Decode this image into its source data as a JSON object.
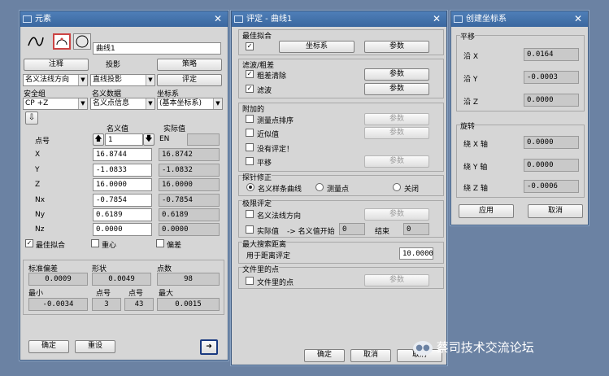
{
  "w1": {
    "title": "元素",
    "name_value": "曲线1",
    "note": "注释",
    "proj_label": "投影",
    "strategy": "策略",
    "sel1": "名义法线方向",
    "sel2": "直线投影",
    "eval": "评定",
    "col_safety": "安全组",
    "col_nominal_data": "名义数据",
    "col_coord": "坐标系",
    "sel3": "CP +Z",
    "sel4": "名义点信息",
    "sel5": "(基本坐标系)",
    "head_point": "点号",
    "head_nominal": "名义值",
    "head_actual": "实际值",
    "point_no": "1",
    "en": "EN",
    "rows": [
      {
        "label": "X",
        "nominal": "16.8744",
        "actual": "16.8742"
      },
      {
        "label": "Y",
        "nominal": "-1.0833",
        "actual": "-1.0832"
      },
      {
        "label": "Z",
        "nominal": "16.0000",
        "actual": "16.0000"
      },
      {
        "label": "Nx",
        "nominal": "-0.7854",
        "actual": "-0.7854"
      },
      {
        "label": "Ny",
        "nominal": "0.6189",
        "actual": "0.6189"
      },
      {
        "label": "Nz",
        "nominal": "0.0000",
        "actual": "0.0000"
      }
    ],
    "chk_bestfit": "最佳拟合",
    "chk_centroid": "重心",
    "chk_dev": "偏差",
    "stat_std": "标准偏差",
    "stat_shape": "形状",
    "stat_points": "点数",
    "std_val": "0.0009",
    "shape_val": "0.0049",
    "points_val": "98",
    "stat_min": "最小",
    "stat_pno1": "点号",
    "stat_pno2": "点号",
    "stat_max": "最大",
    "min_val": "-0.0034",
    "pno1_val": "3",
    "pno2_val": "43",
    "max_val": "0.0015",
    "ok": "确定",
    "reset": "重设"
  },
  "w2": {
    "title": "评定 - 曲线1",
    "best_fit": "最佳拟合",
    "coord_btn": "坐标系",
    "param": "参数",
    "filter_group": "滤波/粗差",
    "outlier": "粗差清除",
    "filter": "滤波",
    "extra_group": "附加的",
    "sort": "测量点排序",
    "approx": "近似值",
    "not_eval": "没有评定！",
    "shift": "平移",
    "probe_group": "探针修正",
    "r_nominal": "名义样条曲线",
    "r_meas": "测量点",
    "r_off": "关闭",
    "limit_group": "极限评定",
    "nominal_normal": "名义法线方向",
    "actual": "实际值",
    "arrow": "-> 名义值开始",
    "start_val": "0",
    "end_label": "结束",
    "end_val": "0",
    "maxdist_group": "最大搜索距离",
    "for_dist": "用于距离评定",
    "dist_val": "10.0000",
    "file_group": "文件里的点",
    "file_chk": "文件里的点",
    "ok": "确定",
    "cancel": "取消",
    "last_btn": "取消"
  },
  "w3": {
    "title": "创建坐标系",
    "shift_group": "平移",
    "along_x": "沿 X",
    "along_y": "沿 Y",
    "along_z": "沿 Z",
    "vx": "0.0164",
    "vy": "-0.0003",
    "vz": "0.0000",
    "rot_group": "旋转",
    "rot_x": "绕 X 轴",
    "rot_y": "绕 Y 轴",
    "rot_z": "绕 Z 轴",
    "rx": "0.0000",
    "ry": "0.0000",
    "rz": "-0.0006",
    "apply": "应用",
    "cancel": "取消"
  },
  "watermark": "蔡司技术交流论坛"
}
